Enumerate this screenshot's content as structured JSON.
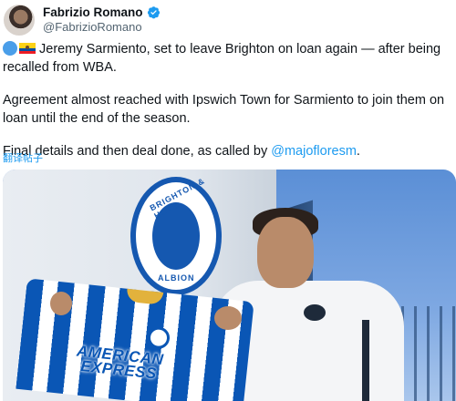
{
  "author": {
    "display_name": "Fabrizio Romano",
    "handle": "@FabrizioRomano"
  },
  "tweet": {
    "line1": " Jeremy Sarmiento, set to leave Brighton on loan again — after being recalled from WBA.",
    "line2": "Agreement almost reached with Ipswich Town for Sarmiento to join them on loan until the end of the season.",
    "line3_prefix": "Final details and then deal done, as called by ",
    "line3_mention": "@majofloresm",
    "line3_suffix": "."
  },
  "translate_label": "翻译帖子",
  "photo": {
    "crest_top": "BRIGHTON & HOVE",
    "crest_bottom": "ALBION",
    "sponsor_line1": "AMERICAN",
    "sponsor_line2": "EXPRESS"
  },
  "colors": {
    "link": "#1d9bf0",
    "brighton_blue": "#0a56b5"
  }
}
